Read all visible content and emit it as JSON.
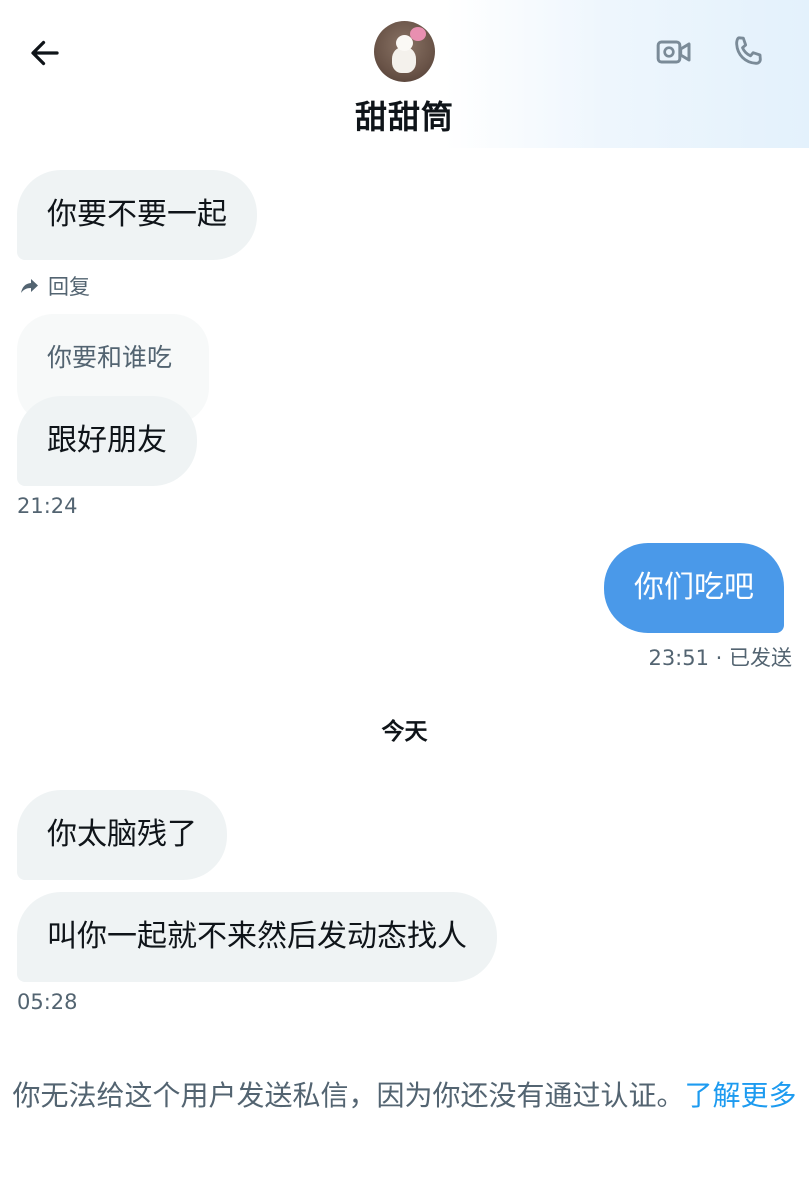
{
  "header": {
    "back_icon": "arrow-left-icon",
    "contact_name": "甜甜筒",
    "video_icon": "video-call-icon",
    "call_icon": "phone-icon"
  },
  "messages": {
    "m1": "你要不要一起",
    "reply_label": "回复",
    "quoted_text": "你要和谁吃",
    "m2": "跟好朋友",
    "time1": "21:24",
    "m3": "你们吃吧",
    "time2": "23:51 · 已发送",
    "day_separator": "今天",
    "m4": "你太脑残了",
    "m5": "叫你一起就不来然后发动态找人",
    "time3": "05:28"
  },
  "notice": {
    "text": "你无法给这个用户发送私信，因为你还没有通过认证。",
    "link": "了解更多"
  },
  "colors": {
    "accent": "#1d9bf0",
    "sent_bubble": "#4a99e9",
    "received_bubble": "#eff3f4"
  }
}
